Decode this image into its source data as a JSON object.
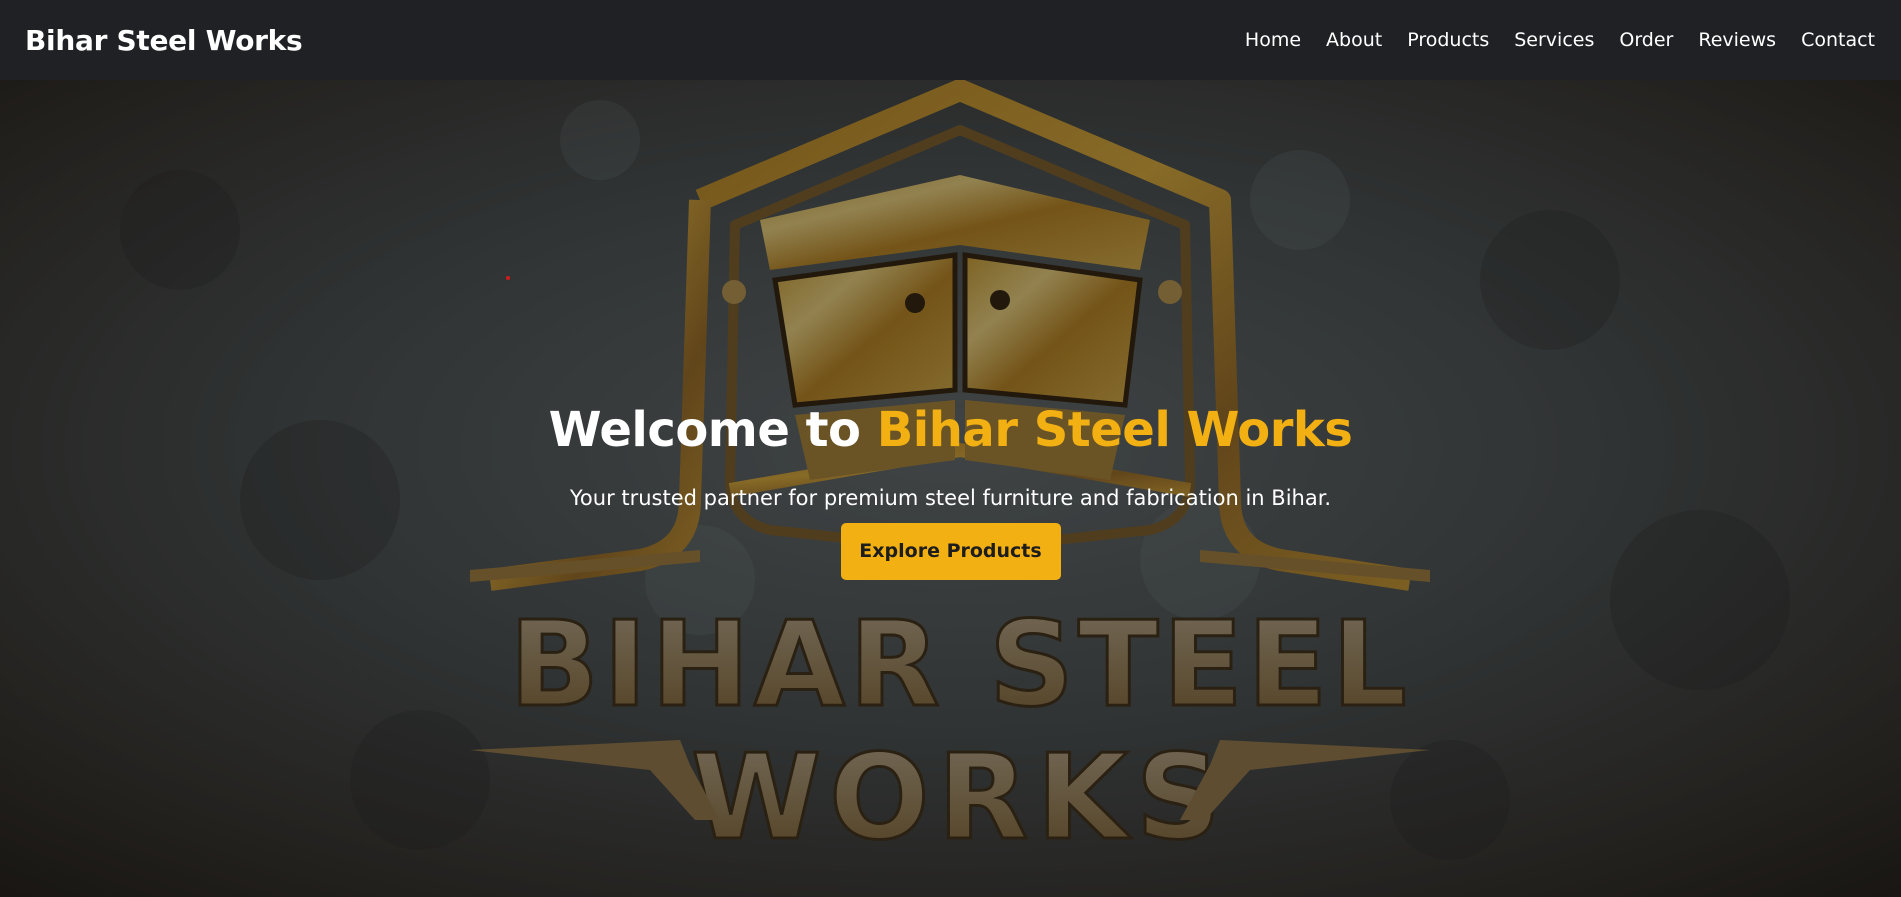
{
  "navbar": {
    "brand": "Bihar Steel Works",
    "links": [
      "Home",
      "About",
      "Products",
      "Services",
      "Order",
      "Reviews",
      "Contact"
    ]
  },
  "hero": {
    "title_prefix": "Welcome to ",
    "title_accent": "Bihar Steel Works",
    "subtitle": "Your trusted partner for premium steel furniture and fabrication in Bihar.",
    "cta_label": "Explore Products",
    "background_logo": {
      "line1": "BIHAR STEEL",
      "line2": "WORKS"
    }
  },
  "colors": {
    "navbar_bg": "#1f2125",
    "accent": "#f3b012",
    "text": "#ffffff",
    "cta_text": "#1d1d1d"
  },
  "icons": {
    "logo_emblem": "steel-cabinet-emblem"
  }
}
